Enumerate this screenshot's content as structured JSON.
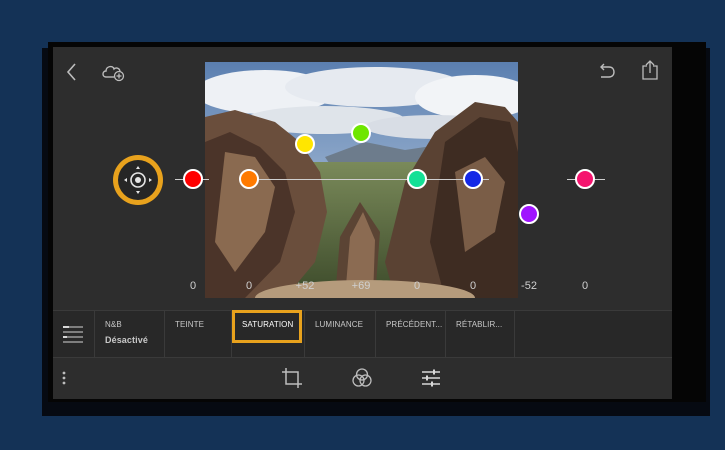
{
  "colors": {
    "background": "#143256",
    "highlight": "#e8a21d",
    "panel": "#2d2d2d"
  },
  "icons": {
    "back": "chevron-left-icon",
    "cloud": "cloud-add-icon",
    "undo": "undo-icon",
    "share": "share-icon",
    "target": "target-adjust-icon",
    "menu": "list-menu-icon",
    "more": "more-vertical-icon",
    "crop": "crop-icon",
    "color": "color-circles-icon",
    "adjust": "sliders-icon"
  },
  "hsl": {
    "channels": [
      {
        "name": "rouge",
        "color": "#ff0000",
        "value": "0"
      },
      {
        "name": "orange",
        "color": "#ff7a00",
        "value": "0"
      },
      {
        "name": "jaune",
        "color": "#ffe600",
        "value": "+52"
      },
      {
        "name": "vert",
        "color": "#6ee600",
        "value": "+69"
      },
      {
        "name": "aqua",
        "color": "#14e096",
        "value": "0"
      },
      {
        "name": "bleu",
        "color": "#1428e6",
        "value": "0"
      },
      {
        "name": "violet",
        "color": "#a014ff",
        "value": "-52"
      },
      {
        "name": "magenta",
        "color": "#f5146e",
        "value": "0"
      }
    ]
  },
  "tabs": {
    "bw": {
      "label": "N&B",
      "sub": "Désactivé"
    },
    "tint": "TEINTE",
    "saturation": "SATURATION",
    "luminance": "LUMINANCE",
    "previous": "PRÉCÉDENT...",
    "reset": "RÉTABLIR..."
  }
}
